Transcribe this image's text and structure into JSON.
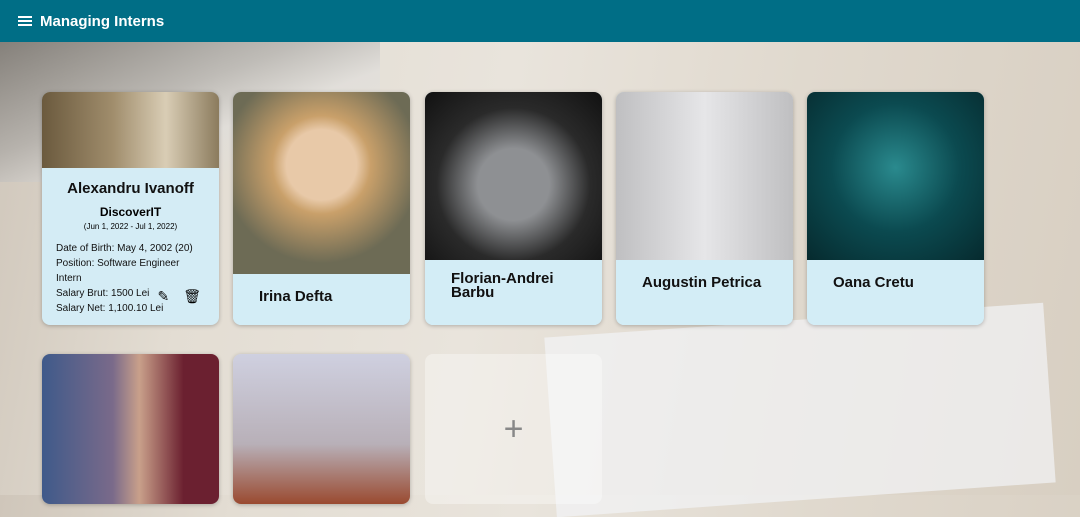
{
  "header": {
    "title": "Managing Interns",
    "menu_icon": "menu-icon"
  },
  "featured": {
    "name": "Alexandru Ivanoff",
    "company": "DiscoverIT",
    "period": "(Jun 1, 2022 - Jul 1, 2022)",
    "details": [
      "Date of Birth: May 4, 2002 (20)",
      "Position: Software Engineer Intern",
      "Salary Brut: 1500 Lei",
      "Salary Net: 1,100.10 Lei"
    ]
  },
  "interns": [
    {
      "name": "Irina Defta"
    },
    {
      "name": "Florian-Andrei Barbu"
    },
    {
      "name": "Augustin Petrica"
    },
    {
      "name": "Oana Cretu"
    }
  ],
  "add_label": "+"
}
